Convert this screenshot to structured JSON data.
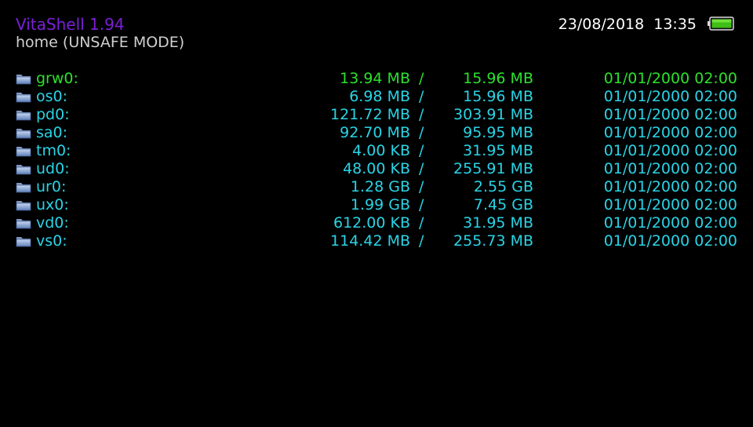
{
  "app": {
    "title": "VitaShell 1.94",
    "path": "home (UNSAFE MODE)"
  },
  "status": {
    "date": "23/08/2018",
    "time": "13:35",
    "battery_icon": "battery-full-icon"
  },
  "colors": {
    "selected": "#2de02d",
    "normal": "#2ad4e6",
    "title": "#7b1fd6"
  },
  "separator": "/",
  "entries": [
    {
      "name": "grw0:",
      "free": "13.94 MB",
      "total": "15.96 MB",
      "date": "01/01/2000 02:00",
      "selected": true
    },
    {
      "name": "os0:",
      "free": "6.98 MB",
      "total": "15.96 MB",
      "date": "01/01/2000 02:00"
    },
    {
      "name": "pd0:",
      "free": "121.72 MB",
      "total": "303.91 MB",
      "date": "01/01/2000 02:00"
    },
    {
      "name": "sa0:",
      "free": "92.70 MB",
      "total": "95.95 MB",
      "date": "01/01/2000 02:00"
    },
    {
      "name": "tm0:",
      "free": "4.00 KB",
      "total": "31.95 MB",
      "date": "01/01/2000 02:00"
    },
    {
      "name": "ud0:",
      "free": "48.00 KB",
      "total": "255.91 MB",
      "date": "01/01/2000 02:00"
    },
    {
      "name": "ur0:",
      "free": "1.28 GB",
      "total": "2.55 GB",
      "date": "01/01/2000 02:00"
    },
    {
      "name": "ux0:",
      "free": "1.99 GB",
      "total": "7.45 GB",
      "date": "01/01/2000 02:00"
    },
    {
      "name": "vd0:",
      "free": "612.00 KB",
      "total": "31.95 MB",
      "date": "01/01/2000 02:00"
    },
    {
      "name": "vs0:",
      "free": "114.42 MB",
      "total": "255.73 MB",
      "date": "01/01/2000 02:00"
    }
  ]
}
